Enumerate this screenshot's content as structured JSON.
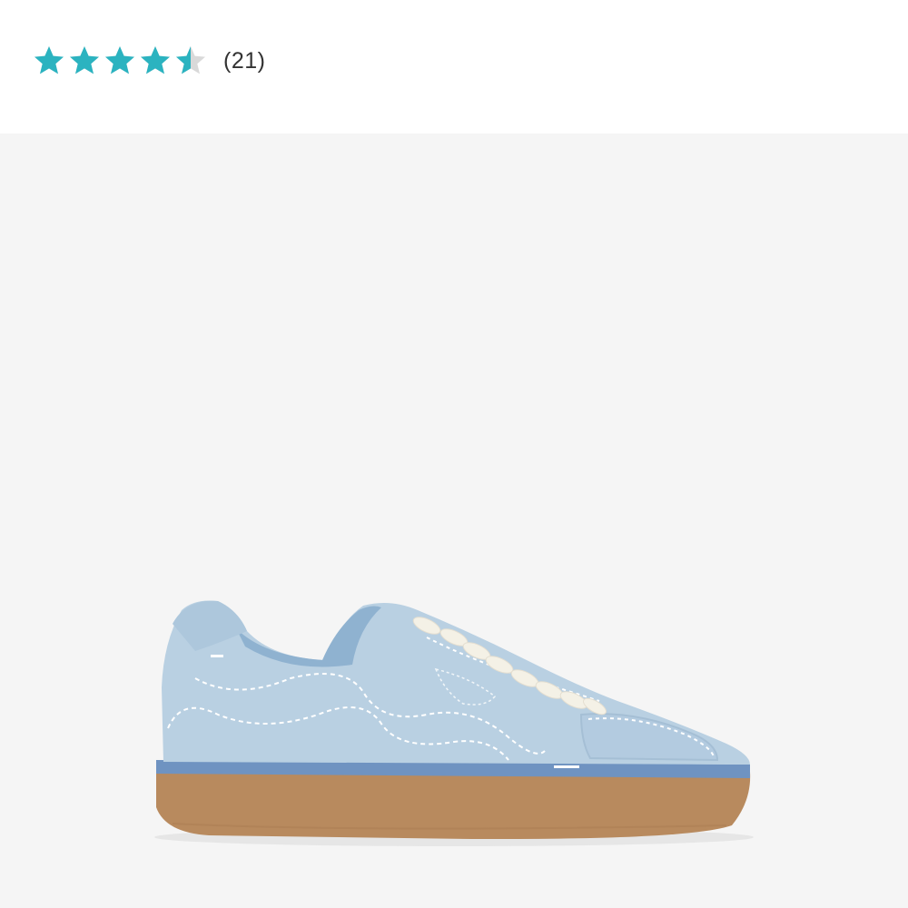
{
  "rating": {
    "value": 4.5,
    "max": 5,
    "review_count": "(21)",
    "star_color": "#2bb3c0",
    "empty_star_color": "#d9d9d9"
  },
  "product_image": {
    "icon": "sneaker-image",
    "upper_color": "#b9d0e2",
    "sole_color": "#b88a5e",
    "midsole_stripe_color": "#6f93c1",
    "background_color": "#f5f5f5"
  }
}
